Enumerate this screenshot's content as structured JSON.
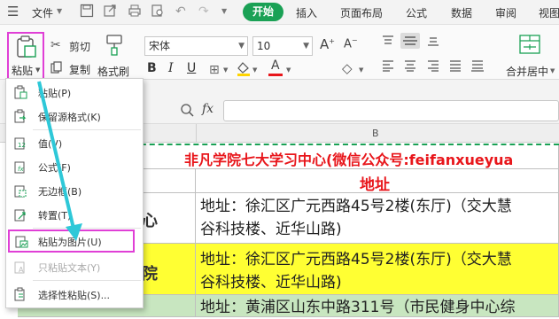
{
  "menubar": {
    "file_label": "文件",
    "tabs": [
      "开始",
      "插入",
      "页面布局",
      "公式",
      "数据",
      "审阅",
      "视图"
    ]
  },
  "ribbon": {
    "paste_label": "粘贴",
    "cut_label": "剪切",
    "copy_label": "复制",
    "format_painter_label": "格式刷",
    "font_name": "宋体",
    "font_size": "10",
    "merge_label": "合并居中"
  },
  "formula_bar": {
    "fx_label": "fx",
    "column_header": "B"
  },
  "sheet": {
    "title": "非凡学院七大学习中心(微信公众号:feifanxueyua",
    "address_header": "地址",
    "rows": [
      {
        "name_fragment": "心",
        "address_line1": "地址：徐汇区广元西路45号2楼(东厅)（交大慧",
        "address_line2": "谷科技楼、近华山路)"
      },
      {
        "name_fragment": "院",
        "address_line1": "地址：徐汇区广元西路45号2楼(东厅)（交大慧",
        "address_line2": "谷科技楼、近华山路)"
      },
      {
        "name_fragment": "",
        "address_line1": "地址：黄浦区山东中路311号（市民健身中心综",
        "address_line2": ""
      }
    ]
  },
  "paste_menu": {
    "items": [
      {
        "label": "粘贴(P)",
        "icon": "paste-icon"
      },
      {
        "label": "保留源格式(K)",
        "icon": "keep-source-format-icon"
      },
      {
        "label": "值(V)",
        "icon": "paste-values-icon"
      },
      {
        "label": "公式(F)",
        "icon": "paste-formula-icon"
      },
      {
        "label": "无边框(B)",
        "icon": "no-borders-icon"
      },
      {
        "label": "转置(T)",
        "icon": "transpose-icon"
      },
      {
        "label": "粘贴为图片(U)",
        "icon": "paste-as-picture-icon"
      },
      {
        "label": "只粘贴文本(Y)",
        "icon": "paste-text-only-icon"
      },
      {
        "label": "选择性粘贴(S)...",
        "icon": "paste-special-icon"
      }
    ]
  },
  "colors": {
    "accent_green": "#1aa155",
    "highlight_magenta": "#e03fd6",
    "arrow_cyan": "#2ec8d8",
    "title_red": "#e8161b",
    "row_yellow": "#ffff33"
  }
}
